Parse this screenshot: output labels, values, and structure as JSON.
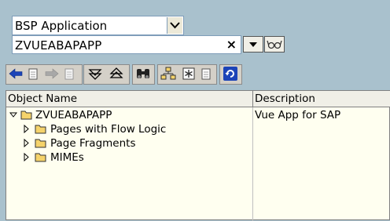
{
  "object_type": {
    "selected": "BSP Application"
  },
  "object_name": {
    "value": "ZVUEABAPAPP",
    "clear_label": "×"
  },
  "tree": {
    "columns": [
      "Object Name",
      "Description"
    ],
    "root": {
      "name": "ZVUEABAPAPP",
      "description": "Vue App for SAP"
    },
    "children": [
      {
        "name": "Pages with Flow Logic"
      },
      {
        "name": "Page Fragments"
      },
      {
        "name": "MIMEs"
      }
    ]
  },
  "colors": {
    "background": "#a9c1cd",
    "tree_bg": "#fffff0",
    "folder": "#f5d36b",
    "arrow_blue": "#1c44b8"
  }
}
